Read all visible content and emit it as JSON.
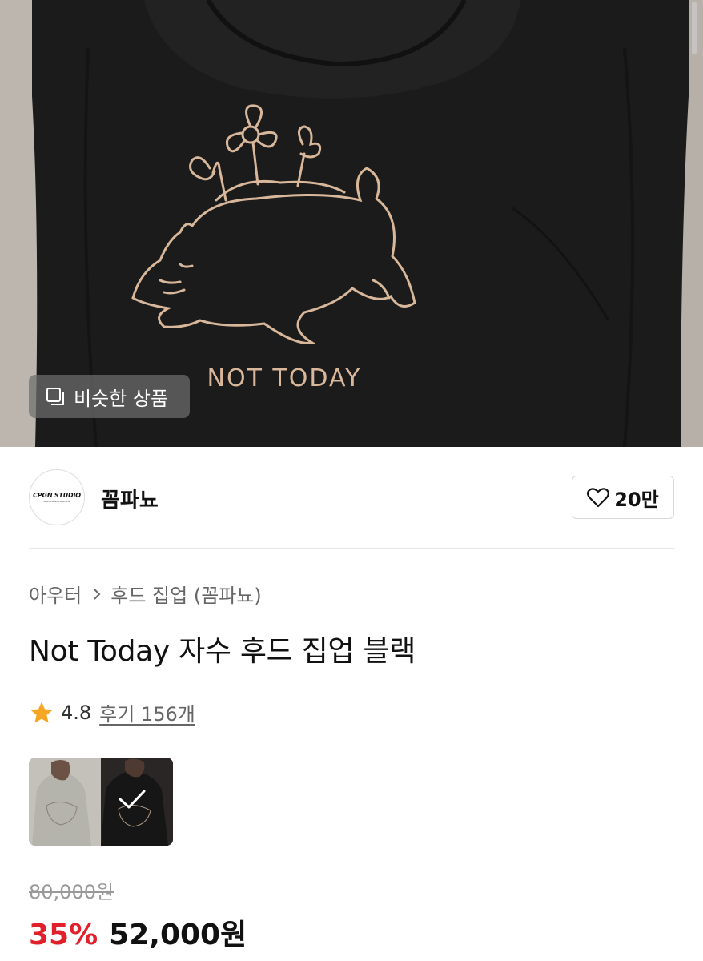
{
  "hero": {
    "embroidery_text": "NOT TODAY",
    "similar_button_label": "비슷한 상품"
  },
  "seller": {
    "logo_text": "CPGN STUDIO",
    "name": "꼼파뇨",
    "like_count": "20만"
  },
  "breadcrumb": {
    "category": "아우터",
    "subcategory": "후드 집업 (꼼파뇨)"
  },
  "product": {
    "title": "Not Today 자수 후드 집업 블랙"
  },
  "rating": {
    "score": "4.8",
    "reviews_label": "후기 156개"
  },
  "options": {
    "thumbnails": [
      {
        "color": "gray",
        "selected": false
      },
      {
        "color": "black",
        "selected": true
      }
    ]
  },
  "pricing": {
    "original_price": "80,000원",
    "discount": "35%",
    "price": "52,000원"
  },
  "colors": {
    "discount_red": "#e0202a",
    "star_orange": "#f5a623",
    "hoodie_black": "#1a1a1b",
    "embroidery": "#d8b79a"
  }
}
